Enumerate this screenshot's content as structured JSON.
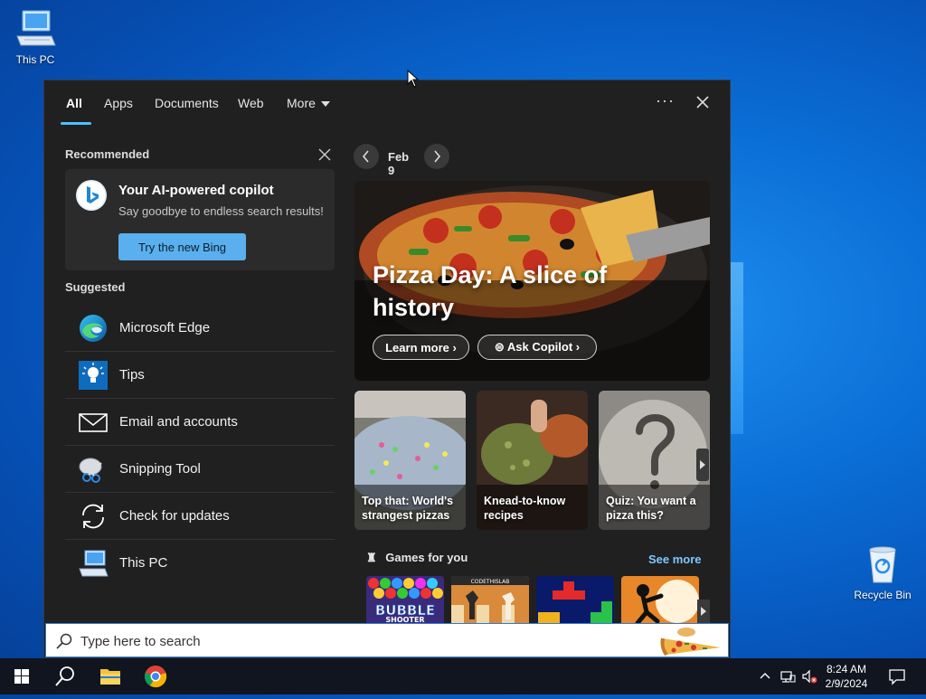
{
  "desktop": {
    "this_pc_label": "This PC",
    "recycle_label": "Recycle Bin"
  },
  "tabs": [
    {
      "label": "All",
      "active": true
    },
    {
      "label": "Apps"
    },
    {
      "label": "Documents"
    },
    {
      "label": "Web"
    },
    {
      "label": "More"
    }
  ],
  "recommended": {
    "title": "Recommended",
    "card_title": "Your AI-powered copilot",
    "card_sub": "Say goodbye to endless search results!",
    "button": "Try the new Bing"
  },
  "suggested": {
    "title": "Suggested",
    "items": [
      {
        "label": "Microsoft Edge",
        "icon": "edge-icon"
      },
      {
        "label": "Tips",
        "icon": "tips-icon"
      },
      {
        "label": "Email and accounts",
        "icon": "mail-icon"
      },
      {
        "label": "Snipping Tool",
        "icon": "snipping-tool-icon"
      },
      {
        "label": "Check for updates",
        "icon": "update-icon"
      },
      {
        "label": "This PC",
        "icon": "computer-icon"
      }
    ]
  },
  "highlights": {
    "date": "Feb 9",
    "hero_title": "Pizza Day: A slice of history",
    "learn_more": "Learn more",
    "ask_copilot": "Ask Copilot",
    "cards": [
      {
        "label": "Top that: World's strangest pizzas"
      },
      {
        "label": "Knead-to-know recipes"
      },
      {
        "label": "Quiz: You want a pizza this?"
      }
    ],
    "games_title": "Games for you",
    "see_more": "See more",
    "game_texts": [
      "BUBBLE",
      "SHOOTER",
      "CODETHISLAB"
    ]
  },
  "search": {
    "placeholder": "Type here to search"
  },
  "taskbar": {
    "time": "8:24 AM",
    "date": "2/9/2024"
  },
  "colors": {
    "accent": "#4cc2ff",
    "bing_button": "#5ab0ee",
    "link": "#7fc7ff"
  }
}
